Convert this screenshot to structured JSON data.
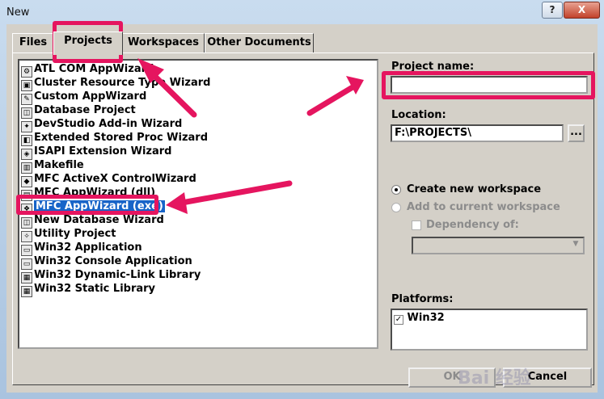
{
  "window": {
    "title": "New",
    "help_label": "?",
    "close_label": "X"
  },
  "tabs": [
    "Files",
    "Projects",
    "Workspaces",
    "Other Documents"
  ],
  "project_types": [
    "ATL COM AppWizard",
    "Cluster Resource Type Wizard",
    "Custom AppWizard",
    "Database Project",
    "DevStudio Add-in Wizard",
    "Extended Stored Proc Wizard",
    "ISAPI Extension Wizard",
    "Makefile",
    "MFC ActiveX ControlWizard",
    "MFC AppWizard (dll)",
    "MFC AppWizard (exe)",
    "New Database Wizard",
    "Utility Project",
    "Win32 Application",
    "Win32 Console Application",
    "Win32 Dynamic-Link Library",
    "Win32 Static Library"
  ],
  "selected_index": 10,
  "project_name": {
    "label": "Project name:",
    "value": ""
  },
  "location": {
    "label": "Location:",
    "value": "F:\\PROJECTS\\",
    "browse_label": "..."
  },
  "workspace": {
    "create_label": "Create new workspace",
    "add_label": "Add to current workspace",
    "dependency_label": "Dependency of:"
  },
  "platforms": {
    "label": "Platforms:",
    "items": [
      "Win32"
    ]
  },
  "buttons": {
    "ok": "OK",
    "cancel": "Cancel"
  },
  "watermark": "Bai 经验",
  "colors": {
    "highlight": "#e5155f",
    "selection": "#1864c8"
  }
}
